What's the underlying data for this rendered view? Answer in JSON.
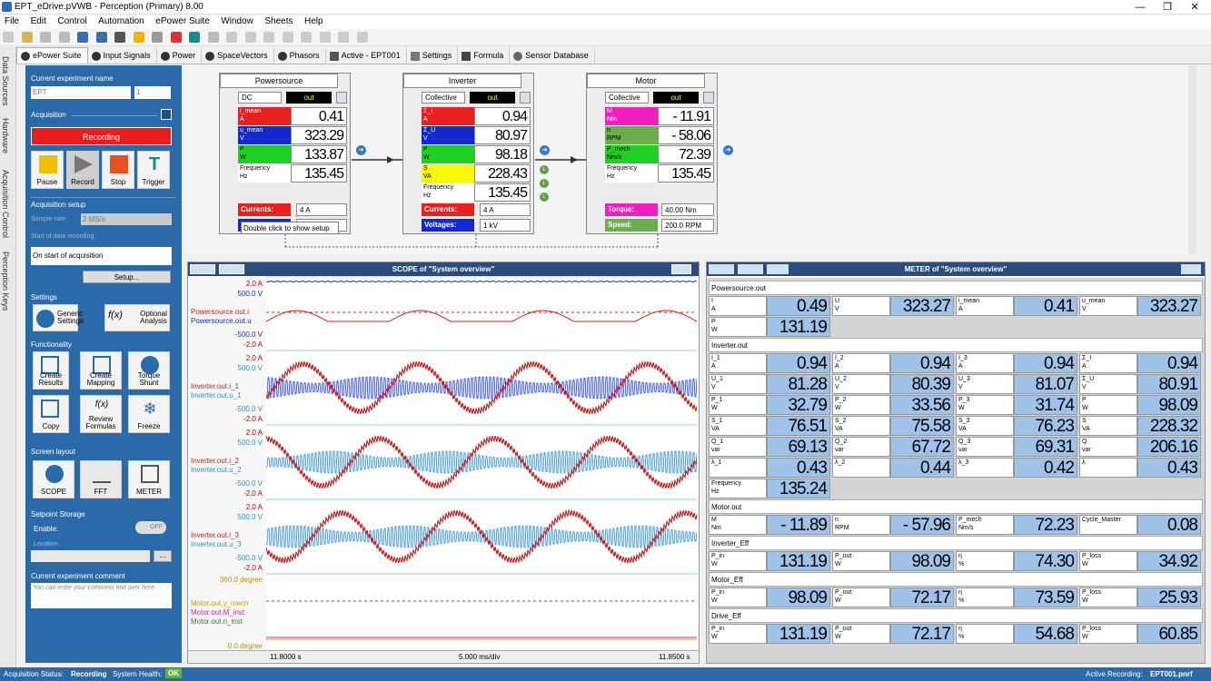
{
  "window": {
    "title": "EPT_eDrive.pVWB - Perception (Primary) 8.00",
    "min": "—",
    "max": "❐",
    "close": "✕"
  },
  "menu": [
    "File",
    "Edit",
    "Control",
    "Automation",
    "ePower Suite",
    "Window",
    "Sheets",
    "Help"
  ],
  "tabs": [
    "ePower Suite",
    "Input Signals",
    "Power",
    "SpaceVectors",
    "Phasors",
    "Active - EPT001",
    "Settings",
    "Formula",
    "Sensor Database"
  ],
  "vstrip": [
    "Data Sources",
    "Hardware",
    "Acquisition Control",
    "Perception Keys"
  ],
  "left": {
    "exp_name_label": "Current experiment name",
    "exp_name": "EPT",
    "exp_num": "1",
    "acquisition": "Acquisition",
    "recording": "Recording",
    "buttons": {
      "pause": "Pause",
      "record": "Record",
      "stop": "Stop",
      "trigger": "Trigger"
    },
    "setup": "Acquisition setup",
    "sample_rate_label": "Sample rate:",
    "sample_rate": "2 MS/s",
    "start_label": "Start of data recording:",
    "start_value": "On start of acquisition",
    "setup_btn": "Setup...",
    "settings": "Settings",
    "generic": "Generic Settings",
    "optional": "Optional Analysis",
    "functionality": "Functionality",
    "create_results": "Create Results",
    "create_mapping": "Create Mapping",
    "torque_shunt": "Torque Shunt",
    "copy": "Copy",
    "review_formulas": "Review Formulas",
    "freeze": "Freeze",
    "screen_layout": "Screen layout",
    "scope": "SCOPE",
    "fft": "FFT",
    "meter": "METER",
    "setpoint": "Setpoint Storage",
    "enable": "Enable:",
    "off": "OFF",
    "location": "Location:",
    "browse": "...",
    "comment_label": "Current experiment comment",
    "comment_placeholder": "You can enter your comment text over here"
  },
  "blocks": {
    "power": {
      "title": "Powersource",
      "mode": "DC",
      "out": "out",
      "rows": [
        {
          "l1": "i_mean",
          "l2": "A",
          "v": "0.41"
        },
        {
          "l1": "u_mean",
          "l2": "V",
          "v": "323.29"
        },
        {
          "l1": "P",
          "l2": "W",
          "v": "133.87"
        },
        {
          "l1": "Frequency",
          "l2": "Hz",
          "v": "135.45"
        }
      ],
      "ctl1": "Currents:",
      "ctl1v": "4 A",
      "tooltip": "Double click to show setup"
    },
    "inv": {
      "title": "Inverter",
      "mode": "Collective",
      "out": "out",
      "rows": [
        {
          "l1": "Σ_I",
          "l2": "A",
          "v": "0.94"
        },
        {
          "l1": "Σ_U",
          "l2": "V",
          "v": "80.97"
        },
        {
          "l1": "P",
          "l2": "W",
          "v": "98.18"
        },
        {
          "l1": "S",
          "l2": "VA",
          "v": "228.43"
        },
        {
          "l1": "Frequency",
          "l2": "Hz",
          "v": "135.45"
        }
      ],
      "ctl1": "Currents:",
      "ctl1v": "4 A",
      "ctl2": "Voltages:",
      "ctl2v": "1 kV",
      "led": "L"
    },
    "motor": {
      "title": "Motor",
      "mode": "Collective",
      "out": "out",
      "rows": [
        {
          "l1": "M",
          "l2": "Nm",
          "v": "- 11.91"
        },
        {
          "l1": "n",
          "l2": "RPM",
          "v": "- 58.06"
        },
        {
          "l1": "P_mech",
          "l2": "Nm/s",
          "v": "72.39"
        },
        {
          "l1": "Frequency",
          "l2": "Hz",
          "v": "135.45"
        }
      ],
      "ctl1": "Torque:",
      "ctl1v": "40.00 Nm",
      "ctl2": "Speed:",
      "ctl2v": "200.0 RPM"
    }
  },
  "scope": {
    "title": "SCOPE of \"System overview\"",
    "labels": [
      {
        "top": "2.0  A",
        "top2": "500.0  V",
        "s1": "Powersource.out.i",
        "s2": "Powersource.out.u",
        "b1": "-500.0  V",
        "b2": "-2.0  A"
      },
      {
        "top": "2.0  A",
        "top2": "500.0  V",
        "s1": "Inverter.out.i_1",
        "s2": "Inverter.out.u_1",
        "b1": "-500.0  V",
        "b2": "-2.0  A"
      },
      {
        "top": "2.0  A",
        "top2": "500.0  V",
        "s1": "Inverter.out.i_2",
        "s2": "Inverter.out.u_2",
        "b1": "-500.0  V",
        "b2": "-2.0  A"
      },
      {
        "top": "2.0  A",
        "top2": "500.0  V",
        "s1": "Inverter.out.i_3",
        "s2": "Inverter.out.u_3",
        "b1": "-500.0  V",
        "b2": "-2.0  A"
      }
    ],
    "deg_top": "360.0  degree",
    "motor1": "Motor.out.y_mech",
    "motor2": "Motor.out.M_inst",
    "motor3": "Motor.out.n_inst",
    "deg_bot": "0.0  degree",
    "t_start": "11.8000 s",
    "t_div": "5.000 ms/div",
    "t_end": "11.8500 s"
  },
  "meter": {
    "title": "METER of \"System overview\"",
    "groups": [
      {
        "name": "Powersource.out",
        "rows": [
          [
            {
              "l1": "I",
              "l2": "A",
              "v": "0.49"
            },
            {
              "l1": "U",
              "l2": "V",
              "v": "323.27"
            },
            {
              "l1": "i_mean",
              "l2": "A",
              "v": "0.41"
            },
            {
              "l1": "u_mean",
              "l2": "V",
              "v": "323.27"
            }
          ],
          [
            {
              "l1": "P",
              "l2": "W",
              "v": "131.19"
            }
          ]
        ]
      },
      {
        "name": "Inverter.out",
        "rows": [
          [
            {
              "l1": "I_1",
              "l2": "A",
              "v": "0.94"
            },
            {
              "l1": "I_2",
              "l2": "A",
              "v": "0.94"
            },
            {
              "l1": "I_3",
              "l2": "A",
              "v": "0.94"
            },
            {
              "l1": "Σ_I",
              "l2": "A",
              "v": "0.94"
            }
          ],
          [
            {
              "l1": "U_1",
              "l2": "V",
              "v": "81.28"
            },
            {
              "l1": "U_2",
              "l2": "V",
              "v": "80.39"
            },
            {
              "l1": "U_3",
              "l2": "V",
              "v": "81.07"
            },
            {
              "l1": "Σ_U",
              "l2": "V",
              "v": "80.91"
            }
          ],
          [
            {
              "l1": "P_1",
              "l2": "W",
              "v": "32.79"
            },
            {
              "l1": "P_2",
              "l2": "W",
              "v": "33.56"
            },
            {
              "l1": "P_3",
              "l2": "W",
              "v": "31.74"
            },
            {
              "l1": "P",
              "l2": "W",
              "v": "98.09"
            }
          ],
          [
            {
              "l1": "S_1",
              "l2": "VA",
              "v": "76.51"
            },
            {
              "l1": "S_2",
              "l2": "VA",
              "v": "75.58"
            },
            {
              "l1": "S_3",
              "l2": "VA",
              "v": "76.23"
            },
            {
              "l1": "S",
              "l2": "VA",
              "v": "228.32"
            }
          ],
          [
            {
              "l1": "Q_1",
              "l2": "var",
              "v": "69.13"
            },
            {
              "l1": "Q_2",
              "l2": "var",
              "v": "67.72"
            },
            {
              "l1": "Q_3",
              "l2": "var",
              "v": "69.31"
            },
            {
              "l1": "Q",
              "l2": "var",
              "v": "206.16"
            }
          ],
          [
            {
              "l1": "λ_1",
              "l2": "",
              "v": "0.43"
            },
            {
              "l1": "λ_2",
              "l2": "",
              "v": "0.44"
            },
            {
              "l1": "λ_3",
              "l2": "",
              "v": "0.42"
            },
            {
              "l1": "λ",
              "l2": "",
              "v": "0.43"
            }
          ],
          [
            {
              "l1": "Frequency",
              "l2": "Hz",
              "v": "135.24"
            }
          ]
        ]
      },
      {
        "name": "Motor.out",
        "rows": [
          [
            {
              "l1": "M",
              "l2": "Nm",
              "v": "- 11.89"
            },
            {
              "l1": "n",
              "l2": "RPM",
              "v": "- 57.96"
            },
            {
              "l1": "P_mech",
              "l2": "Nm/s",
              "v": "72.23"
            },
            {
              "l1": "Cycle_Master",
              "l2": "",
              "v": "0.08"
            }
          ]
        ]
      },
      {
        "name": "Inverter_Eff",
        "rows": [
          [
            {
              "l1": "P_in",
              "l2": "W",
              "v": "131.19"
            },
            {
              "l1": "P_out",
              "l2": "W",
              "v": "98.09"
            },
            {
              "l1": "η",
              "l2": "%",
              "v": "74.30"
            },
            {
              "l1": "P_loss",
              "l2": "W",
              "v": "34.92"
            }
          ]
        ]
      },
      {
        "name": "Motor_Eff",
        "rows": [
          [
            {
              "l1": "P_in",
              "l2": "W",
              "v": "98.09"
            },
            {
              "l1": "P_out",
              "l2": "W",
              "v": "72.17"
            },
            {
              "l1": "η",
              "l2": "%",
              "v": "73.59"
            },
            {
              "l1": "P_loss",
              "l2": "W",
              "v": "25.93"
            }
          ]
        ]
      },
      {
        "name": "Drive_Eff",
        "rows": [
          [
            {
              "l1": "P_in",
              "l2": "W",
              "v": "131.19"
            },
            {
              "l1": "P_out",
              "l2": "W",
              "v": "72.17"
            },
            {
              "l1": "η",
              "l2": "%",
              "v": "54.68"
            },
            {
              "l1": "P_loss",
              "l2": "W",
              "v": "60.85"
            }
          ]
        ]
      }
    ]
  },
  "status": {
    "acq_label": "Acquisition Status:",
    "acq": "Recording",
    "health_label": "System Health:",
    "health": "OK",
    "active_label": "Active Recording:",
    "active": "EPT001.pnrf"
  }
}
